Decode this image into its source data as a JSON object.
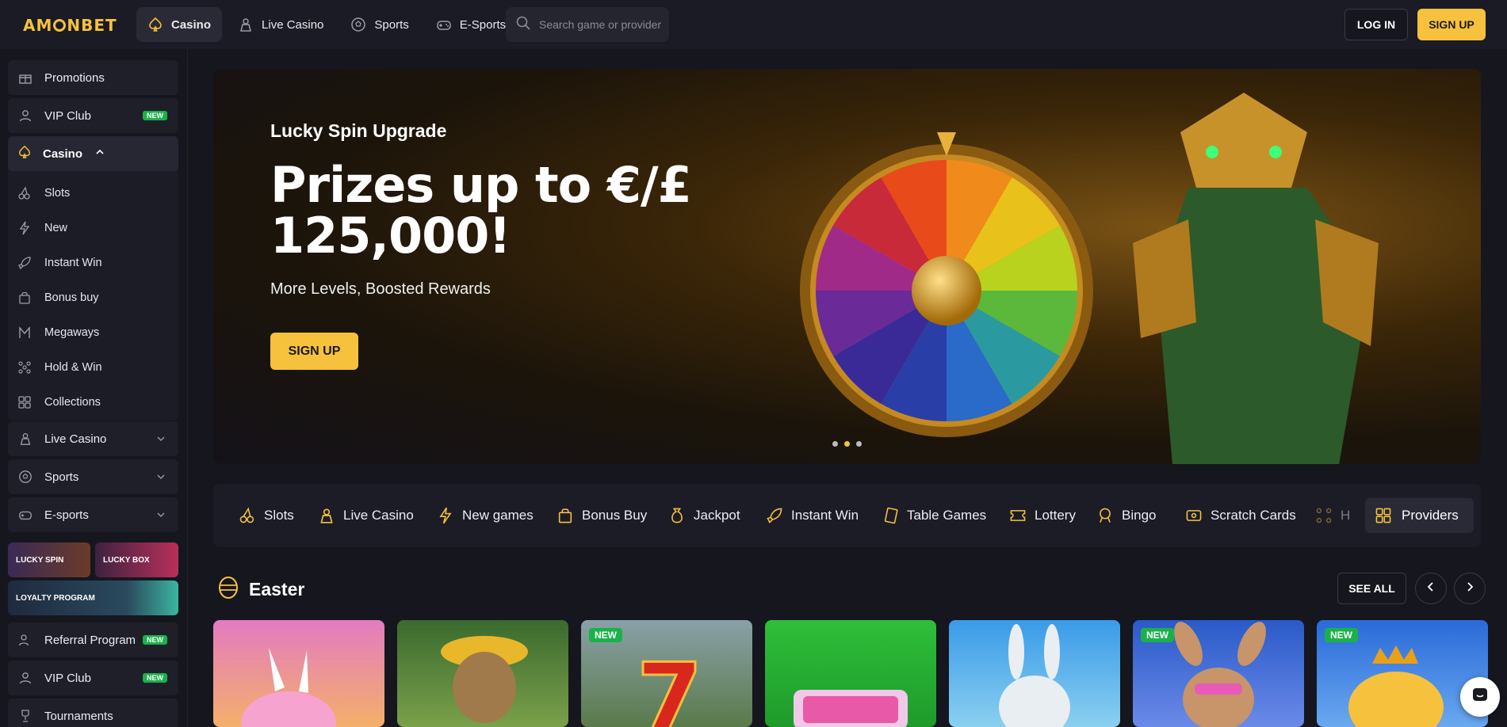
{
  "brand": {
    "logo": "AMONBET"
  },
  "nav": {
    "items": [
      {
        "label": "Casino",
        "icon": "spade-icon",
        "active": true
      },
      {
        "label": "Live Casino",
        "icon": "dealer-icon",
        "active": false
      },
      {
        "label": "Sports",
        "icon": "soccer-ball-icon",
        "active": false
      },
      {
        "label": "E-Sports",
        "icon": "gamepad-icon",
        "active": false
      }
    ],
    "search_placeholder": "Search game or provider",
    "login_label": "LOG IN",
    "signup_label": "SIGN UP"
  },
  "sidebar": {
    "promotions": "Promotions",
    "vip_club": "VIP Club",
    "new_badge": "NEW",
    "casino": "Casino",
    "casino_items": [
      "Slots",
      "New",
      "Instant Win",
      "Bonus buy",
      "Megaways",
      "Hold & Win",
      "Collections"
    ],
    "live_casino": "Live Casino",
    "sports": "Sports",
    "esports": "E-sports",
    "lucky_spin": "LUCKY SPIN",
    "lucky_box": "LUCKY BOX",
    "loyalty_program": "LOYALTY PROGRAM",
    "referral_program": "Referral Program",
    "vip_club_2": "VIP Club",
    "tournaments": "Tournaments"
  },
  "hero": {
    "eyebrow": "Lucky Spin Upgrade",
    "title": "Prizes up to €/£ 125,000!",
    "subtitle": "More Levels, Boosted Rewards",
    "cta": "SIGN UP",
    "slides": 3,
    "active_slide": 2
  },
  "categories": [
    "Slots",
    "Live Casino",
    "New games",
    "Bonus Buy",
    "Jackpot",
    "Instant Win",
    "Table Games",
    "Lottery",
    "Bingo",
    "Scratch Cards",
    "H"
  ],
  "providers_label": "Providers",
  "section": {
    "title": "Easter",
    "see_all": "SEE ALL",
    "cards": [
      {
        "new": false,
        "color": "#e98bb8"
      },
      {
        "new": false,
        "color": "#4c7a3a"
      },
      {
        "new": true,
        "badge": "NEW",
        "color": "#6e8a6a"
      },
      {
        "new": false,
        "color": "#3cc043"
      },
      {
        "new": false,
        "color": "#4a9ed8"
      },
      {
        "new": true,
        "badge": "NEW",
        "color": "#3a66c4"
      },
      {
        "new": true,
        "badge": "NEW",
        "color": "#3c78d8"
      }
    ]
  },
  "colors": {
    "accent": "#f6c13c",
    "background": "#16161f",
    "panel": "#1c1c27",
    "new_badge": "#1bb14a"
  }
}
